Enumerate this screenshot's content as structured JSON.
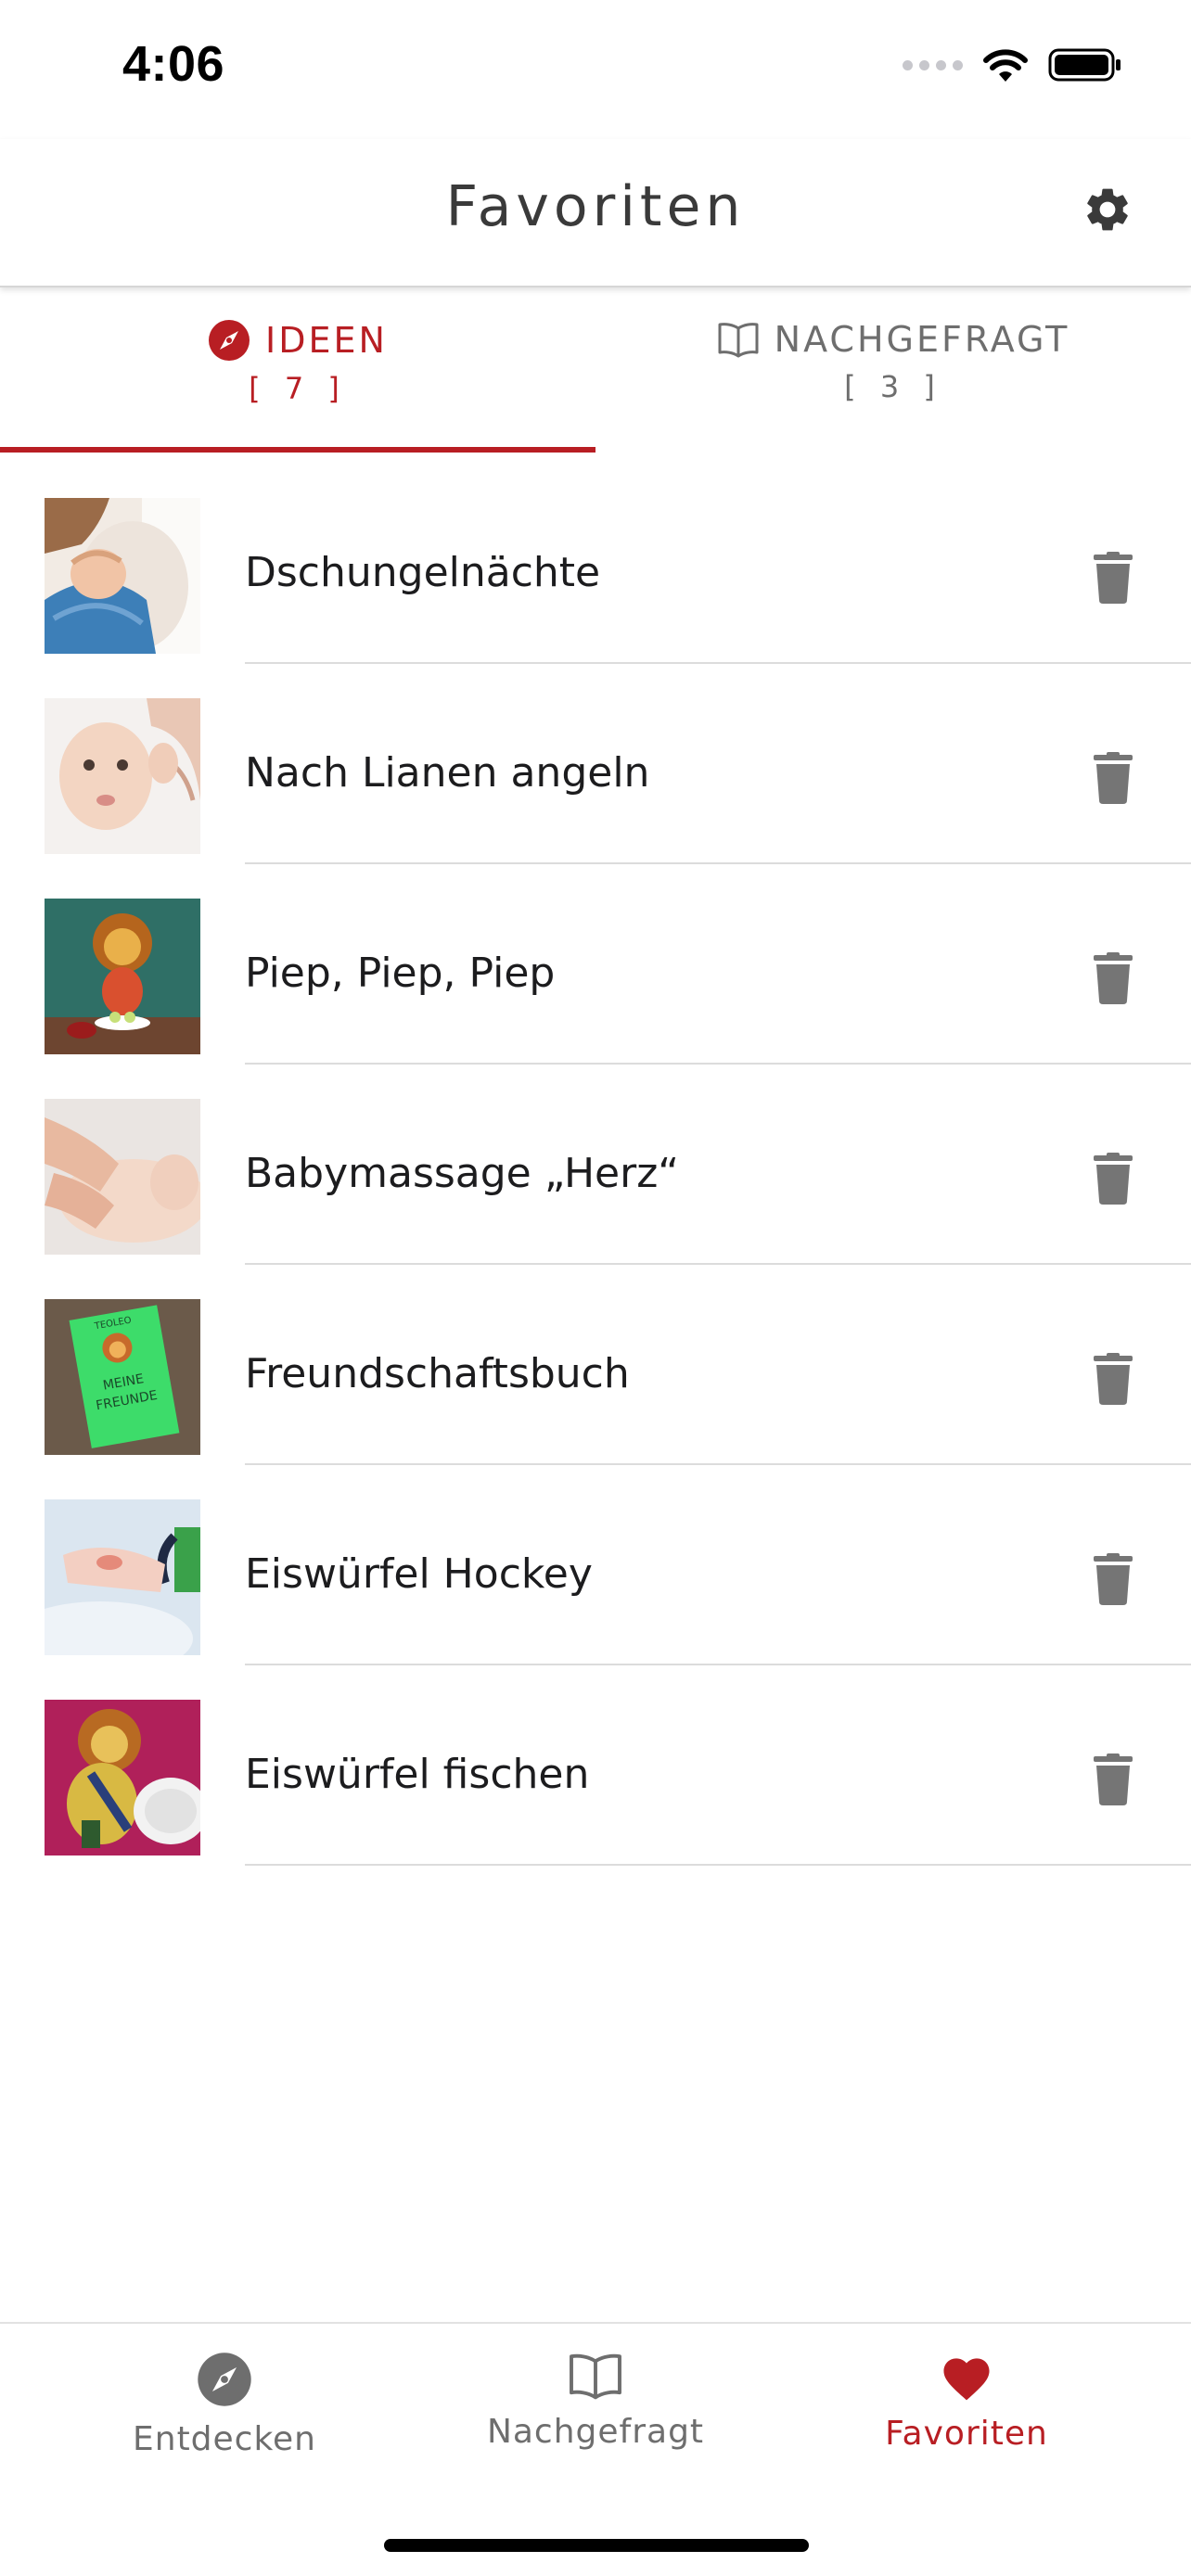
{
  "status_bar": {
    "time": "4:06"
  },
  "header": {
    "title": "Favoriten",
    "settings_icon": "gear-icon"
  },
  "tabs": [
    {
      "label": "IDEEN",
      "count": "[ 7 ]",
      "icon": "compass-icon",
      "active": true
    },
    {
      "label": "NACHGEFRAGT",
      "count": "[ 3 ]",
      "icon": "book-open-icon",
      "active": false
    }
  ],
  "favorites": [
    {
      "title": "Dschungelnächte"
    },
    {
      "title": "Nach Lianen angeln"
    },
    {
      "title": "Piep, Piep, Piep"
    },
    {
      "title": "Babymassage „Herz“"
    },
    {
      "title": "Freundschaftsbuch",
      "thumb_text": [
        "TEOLEO",
        "MEINE",
        "FREUNDE"
      ]
    },
    {
      "title": "Eiswürfel Hockey"
    },
    {
      "title": "Eiswürfel fischen"
    }
  ],
  "tabbar": [
    {
      "label": "Entdecken",
      "icon": "compass-icon",
      "active": false
    },
    {
      "label": "Nachgefragt",
      "icon": "book-open-icon",
      "active": false
    },
    {
      "label": "Favoriten",
      "icon": "heart-icon",
      "active": true
    }
  ],
  "colors": {
    "accent": "#b81e23",
    "inactive": "#6e6e6e",
    "icon_gray": "#757575"
  }
}
